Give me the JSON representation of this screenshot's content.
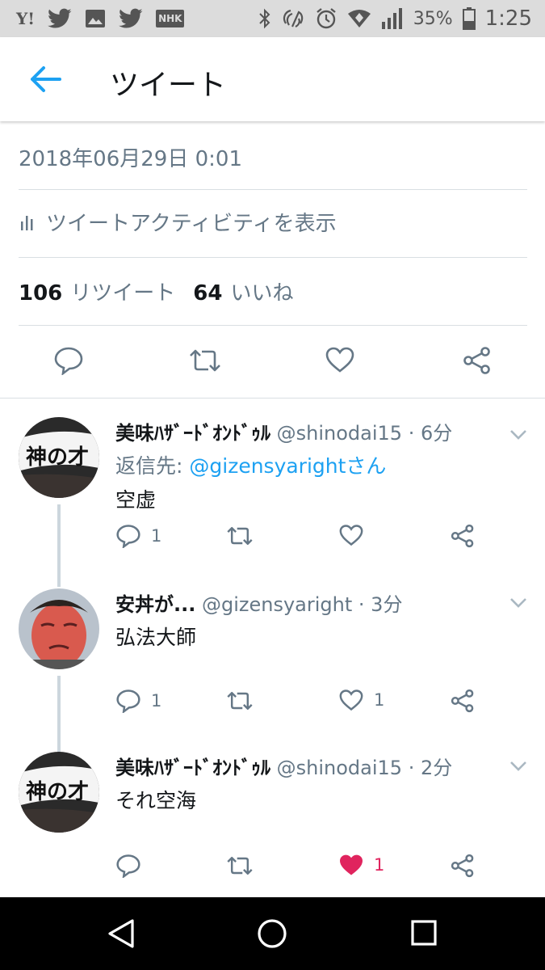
{
  "status_bar": {
    "left_icons": [
      "yahoo-japan-icon",
      "twitter-bird-icon",
      "image-icon",
      "twitter-bird-icon",
      "nhk-icon"
    ],
    "yahoo_text": "Y!",
    "nhk_text": "NHK",
    "right_icons": [
      "bluetooth-icon",
      "nfc-icon",
      "alarm-icon",
      "wifi-icon",
      "signal-icon",
      "battery-icon"
    ],
    "battery": "35%",
    "time": "1:25"
  },
  "app_bar": {
    "back_icon": "arrow-left-icon",
    "title": "ツイート",
    "accent": "#1da1f2"
  },
  "tweet": {
    "timestamp": "2018年06月29日 0:01",
    "activity_label": "ツイートアクティビティを表示",
    "retweet_count": "106",
    "retweet_label": "リツイート",
    "like_count": "64",
    "like_label": "いいね",
    "actions": [
      "reply-icon",
      "retweet-icon",
      "heart-icon",
      "share-icon"
    ]
  },
  "replies": [
    {
      "name": "美味ﾊｻﾞｰﾄﾞｵﾝﾄﾞｩﾙ",
      "handle": "@shinodai15",
      "time": "· 6分",
      "reply_to_label": "返信先: ",
      "reply_to_link": "@gizensyarightさん",
      "text": "空虚",
      "reply_count": "1",
      "retweet_count": "",
      "like_count": "",
      "liked": false
    },
    {
      "name": "安丼が...",
      "handle": "@gizensyaright",
      "time": "· 3分",
      "text": "弘法大師",
      "reply_count": "1",
      "retweet_count": "",
      "like_count": "1",
      "liked": false
    },
    {
      "name": "美味ﾊｻﾞｰﾄﾞｵﾝﾄﾞｩﾙ",
      "handle": "@shinodai15",
      "time": "· 2分",
      "text": "それ空海",
      "reply_count": "",
      "retweet_count": "",
      "like_count": "1",
      "liked": true
    }
  ],
  "avatar_labels": {
    "headband_text": "神の才"
  },
  "colors": {
    "text_secondary": "#657786",
    "link": "#1da1f2",
    "like": "#e0245e",
    "divider": "#d9dfe3"
  },
  "nav_bar": {
    "buttons": [
      "back-triangle-icon",
      "home-circle-icon",
      "recents-square-icon"
    ]
  }
}
